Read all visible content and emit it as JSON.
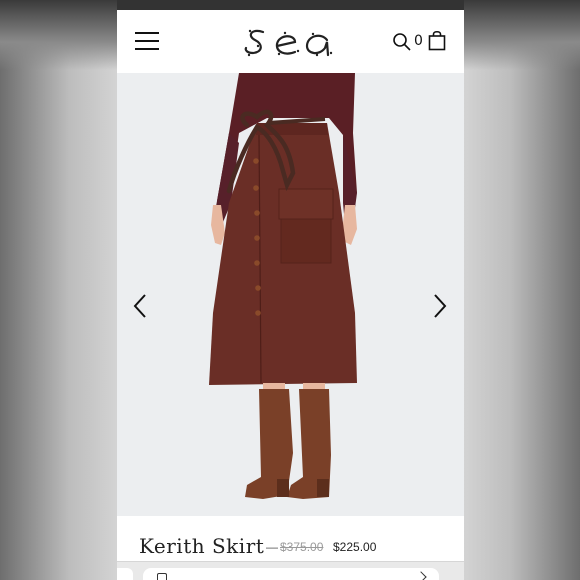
{
  "header": {
    "logo_text": "sea",
    "cart_count": "0",
    "icons": [
      "menu-icon",
      "search-icon",
      "shopping-bag-icon"
    ]
  },
  "gallery": {
    "icons": [
      "chevron-left-icon",
      "chevron-right-icon"
    ]
  },
  "product": {
    "name": "Kerith Skirt",
    "separator": "—",
    "original_price": "$375.00",
    "sale_price": "$225.00"
  },
  "colors": {
    "header_bg": "#ffffff",
    "skirt": "#6a2e26",
    "top": "#5a1f25",
    "boots": "#7a4028",
    "image_bg": "#eceef0"
  }
}
